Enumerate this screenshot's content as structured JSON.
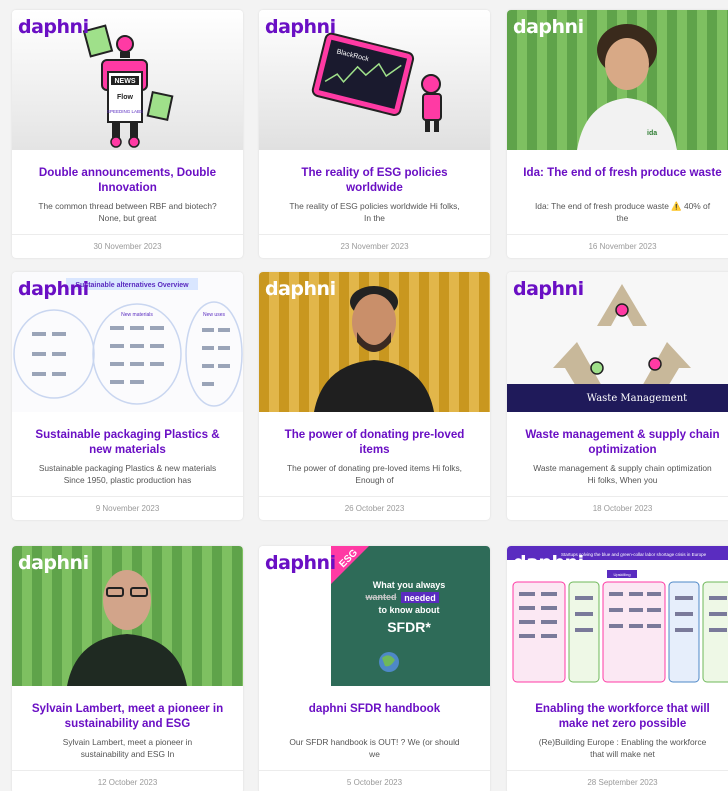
{
  "brand": {
    "logo_text": "daphni",
    "accent": "#6a0fc4"
  },
  "cards": [
    {
      "title": "Double announcements, Double Innovation",
      "excerpt": "The common thread between RBF and biotech? None, but great",
      "date": "30 November 2023",
      "thumb": {
        "logo_color": "purple",
        "labels": [
          "NEWS",
          "Flow",
          "SPEEDING LABS"
        ]
      }
    },
    {
      "title": "The reality of ESG policies worldwide",
      "excerpt": "The reality of ESG policies worldwide Hi folks, In the",
      "date": "23 November 2023",
      "thumb": {
        "logo_color": "purple",
        "labels": [
          "BlackRock"
        ]
      }
    },
    {
      "title": "Ida: The end of fresh produce waste",
      "excerpt": "Ida: The end of fresh produce waste ⚠️ 40% of the",
      "date": "16 November 2023",
      "thumb": {
        "logo_color": "white",
        "labels": [
          "ida"
        ]
      }
    },
    {
      "title": "Sustainable packaging Plastics & new materials",
      "excerpt": "Sustainable packaging Plastics & new materials Since 1950, plastic production has",
      "date": "9 November 2023",
      "thumb": {
        "logo_color": "purple",
        "labels": [
          "Sustainable alternatives Overview",
          "New materials",
          "New uses"
        ]
      }
    },
    {
      "title": "The power of donating pre-loved items",
      "excerpt": "The power of donating pre-loved items Hi folks, Enough of",
      "date": "26 October 2023",
      "thumb": {
        "logo_color": "white",
        "labels": []
      }
    },
    {
      "title": "Waste management & supply chain optimization",
      "excerpt": "Waste management & supply chain optimization Hi folks, When you",
      "date": "18 October 2023",
      "thumb": {
        "logo_color": "purple",
        "labels": [
          "Waste Management"
        ]
      }
    },
    {
      "title": "Sylvain Lambert, meet a pioneer in sustainability and ESG",
      "excerpt": "Sylvain Lambert, meet a pioneer in sustainability and ESG In",
      "date": "12 October 2023",
      "thumb": {
        "logo_color": "white",
        "labels": []
      }
    },
    {
      "title": "daphni SFDR handbook",
      "excerpt": "Our SFDR handbook is OUT! ? We (or should we",
      "date": "5 October 2023",
      "thumb": {
        "logo_color": "purple",
        "labels": [
          "ESG",
          "What you always",
          "wanted",
          "needed",
          "to know about",
          "SFDR*"
        ]
      }
    },
    {
      "title": "Enabling the workforce that will make net zero possible",
      "excerpt": "(Re)Building Europe : Enabling the workforce that will make net",
      "date": "28 September 2023",
      "thumb": {
        "logo_color": "white",
        "labels": [
          "Startups solving the blue and green-collar labor shortage crisis in Europe",
          "Upskilling"
        ]
      }
    }
  ]
}
